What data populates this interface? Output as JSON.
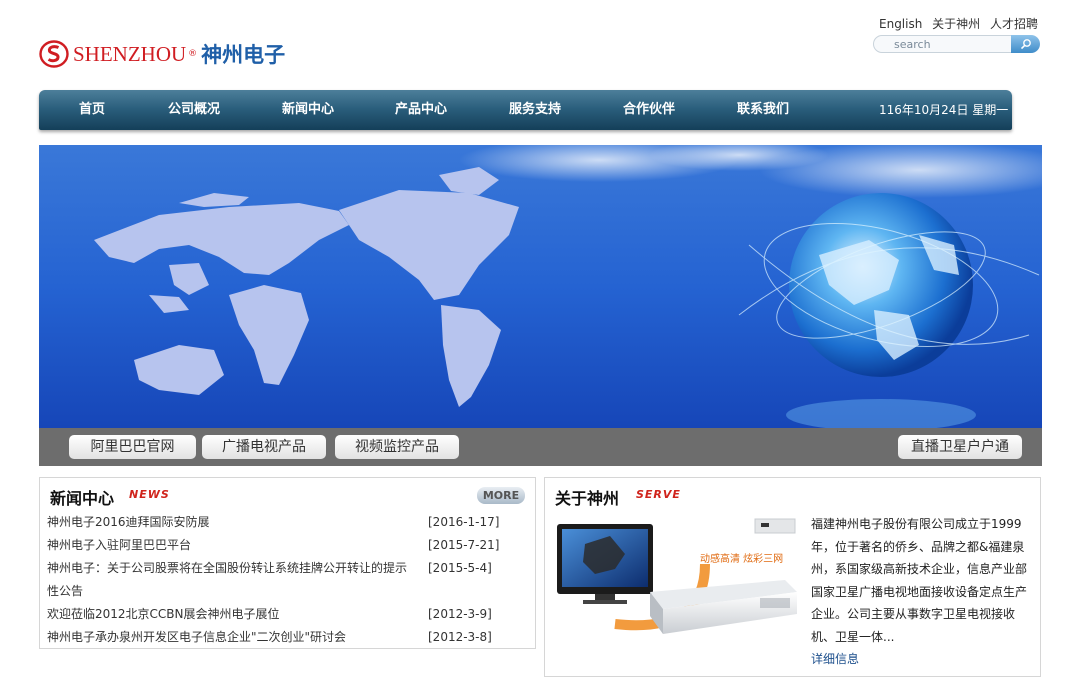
{
  "top_links": [
    "English",
    "关于神州",
    "人才招聘"
  ],
  "search": {
    "placeholder": "search"
  },
  "logo": {
    "en": "SHENZHOU",
    "reg": "®",
    "cn": "神州电子"
  },
  "nav": {
    "items": [
      "首页",
      "公司概况",
      "新闻中心",
      "产品中心",
      "服务支持",
      "合作伙伴",
      "联系我们"
    ],
    "date": "116年10月24日 星期一"
  },
  "quick_links": [
    "阿里巴巴官网",
    "广播电视产品",
    "视频监控产品",
    "直播卫星户户通"
  ],
  "news": {
    "title": "新闻中心",
    "tag": "NEWS",
    "more_label": "MORE",
    "items": [
      {
        "title": "神州电子2016迪拜国际安防展",
        "date": "[2016-1-17]"
      },
      {
        "title": "神州电子入驻阿里巴巴平台",
        "date": "[2015-7-21]"
      },
      {
        "title": "神州电子：关于公司股票将在全国股份转让系统挂牌公开转让的提示性公告",
        "date": "[2015-5-4]"
      },
      {
        "title": "欢迎莅临2012北京CCBN展会神州电子展位",
        "date": "[2012-3-9]"
      },
      {
        "title": "神州电子承办泉州开发区电子信息企业\"二次创业\"研讨会",
        "date": "[2012-3-8]"
      }
    ]
  },
  "about": {
    "title": "关于神州",
    "tag": "SERVE",
    "image_caption": "动感高清 炫彩三网",
    "text": "福建神州电子股份有限公司成立于1999年，位于著名的侨乡、品牌之都&福建泉州，系国家级高新技术企业，信息产业部国家卫星广播电视地面接收设备定点生产企业。公司主要从事数字卫星电视接收机、卫星一体...",
    "more_label": "详细信息"
  },
  "colors": {
    "nav_top": "#4d7f9a",
    "nav_bottom": "#143f59",
    "banner_blue": "#2563d2",
    "accent_red": "#d0241c",
    "logo_blue": "#1f5fa8"
  }
}
